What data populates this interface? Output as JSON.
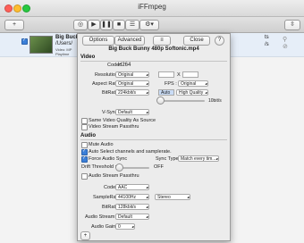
{
  "window": {
    "title": "iFFmpeg",
    "colors": {
      "close": "#ff5f57",
      "minimize": "#febc2e",
      "zoom": "#28c840",
      "accent": "#3b7fd8"
    }
  },
  "toolbar": {
    "add_icon": "add-icon",
    "info_icon": "info-icon",
    "play_icon": "play-icon"
  },
  "file": {
    "name_line1": "Big Buck",
    "name_line2": "/Users/",
    "name_line3": "Video: MP",
    "name_line4": "Playtime"
  },
  "right_col": {
    "line1": "ts",
    "line2": "/s"
  },
  "sheet": {
    "tabs": {
      "options": "Options",
      "advanced": "Advanced",
      "close": "Close",
      "help": "?",
      "file_menu": "≡"
    },
    "filename": "Big Buck Bunny 480p Softonic.mp4",
    "video": {
      "section": "Video",
      "codec_label": "Codec :",
      "codec_value": "H264",
      "resolution_label": "Resolution :",
      "resolution_value": "Original",
      "res_x": "X",
      "aspect_label": "Aspect Ratio :",
      "aspect_value": "Original",
      "fps_label": "FPS :",
      "fps_value": "Original",
      "bitrate_label": "BitRate :",
      "bitrate_value": "224kbit/s",
      "auto_label": "Auto",
      "quality_value": "High Quality",
      "slider_value_label": "10bit/s",
      "vsync_label": "V-Sync :",
      "vsync_value": "Default",
      "same_quality": "Same Video Quality As Source",
      "video_passthru": "Video Stream Passthru"
    },
    "audio": {
      "section": "Audio",
      "mute": "Mute Audio",
      "auto_select": "Auto Select channels and samplerate.",
      "force_sync": "Force Audio Sync",
      "sync_type_label": "Sync Type :",
      "sync_type_value": "Match every tim...",
      "drift_label": "Drift Threshold :",
      "drift_value": "OFF",
      "audio_passthru": "Audio Stream Passthru",
      "codec_label": "Codec :",
      "codec_value": "AAC",
      "samplerate_label": "SampleRate :",
      "samplerate_value": "44100Hz",
      "channels_value": "Stereo",
      "bitrate_label": "BitRate :",
      "bitrate_value": "128kbit/s",
      "stream_label": "Audio Stream :",
      "stream_value": "Default",
      "gain_label": "Audio Gain :",
      "gain_value": "0"
    },
    "add_button": "+"
  }
}
